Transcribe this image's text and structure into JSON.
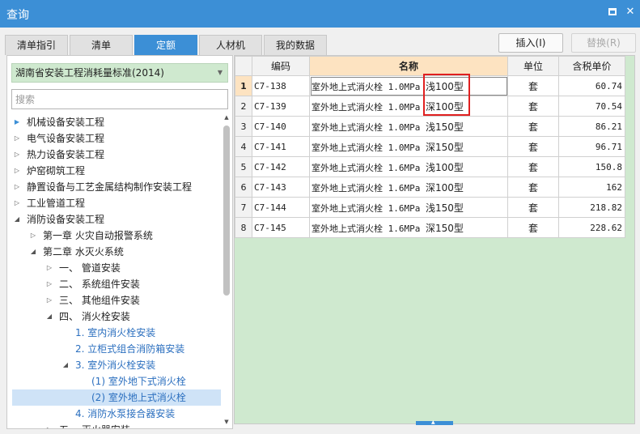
{
  "window": {
    "title": "查询"
  },
  "tabs": [
    {
      "label": "清单指引",
      "active": false
    },
    {
      "label": "清单",
      "active": false
    },
    {
      "label": "定额",
      "active": true
    },
    {
      "label": "人材机",
      "active": false
    },
    {
      "label": "我的数据",
      "active": false
    }
  ],
  "toolbar": {
    "insert_label": "插入(I)",
    "replace_label": "替换(R)"
  },
  "left": {
    "dropdown_value": "湖南省安装工程消耗量标准(2014)",
    "search_placeholder": "搜索",
    "tree": [
      {
        "label": "机械设备安装工程",
        "state": "collapsed",
        "selected_parent": true
      },
      {
        "label": "电气设备安装工程",
        "state": "collapsed"
      },
      {
        "label": "热力设备安装工程",
        "state": "collapsed"
      },
      {
        "label": "炉窑砌筑工程",
        "state": "collapsed"
      },
      {
        "label": "静置设备与工艺金属结构制作安装工程",
        "state": "collapsed"
      },
      {
        "label": "工业管道工程",
        "state": "collapsed"
      },
      {
        "label": "消防设备安装工程",
        "state": "expanded"
      },
      {
        "label": "第一章 火灾自动报警系统",
        "state": "collapsed"
      },
      {
        "label": "第二章 水灭火系统",
        "state": "expanded"
      },
      {
        "label": "一、 管道安装",
        "state": "collapsed"
      },
      {
        "label": "二、 系统组件安装",
        "state": "collapsed"
      },
      {
        "label": "三、 其他组件安装",
        "state": "collapsed"
      },
      {
        "label": "四、 消火栓安装",
        "state": "expanded"
      },
      {
        "label": "1. 室内消火栓安装",
        "state": "leaf"
      },
      {
        "label": "2. 立柜式组合消防箱安装",
        "state": "leaf"
      },
      {
        "label": "3. 室外消火栓安装",
        "state": "expanded"
      },
      {
        "label": "(1) 室外地下式消火栓",
        "state": "leaf"
      },
      {
        "label": "(2) 室外地上式消火栓",
        "state": "leaf",
        "selected": true
      },
      {
        "label": "4. 消防水泵接合器安装",
        "state": "leaf"
      },
      {
        "label": "五、 灭火器安装",
        "state": "collapsed"
      }
    ]
  },
  "grid": {
    "headers": {
      "code": "编码",
      "name": "名称",
      "unit": "单位",
      "price": "含税单价"
    },
    "rows": [
      {
        "no": "1",
        "code": "C7-138",
        "name_main": "室外地上式消火栓 1.0MPa ",
        "name_tail": "浅100型",
        "unit": "套",
        "price": "60.74"
      },
      {
        "no": "2",
        "code": "C7-139",
        "name_main": "室外地上式消火栓 1.0MPa ",
        "name_tail": "深100型",
        "unit": "套",
        "price": "70.54"
      },
      {
        "no": "3",
        "code": "C7-140",
        "name_main": "室外地上式消火栓 1.0MPa ",
        "name_tail": "浅150型",
        "unit": "套",
        "price": "86.21"
      },
      {
        "no": "4",
        "code": "C7-141",
        "name_main": "室外地上式消火栓 1.0MPa ",
        "name_tail": "深150型",
        "unit": "套",
        "price": "96.71"
      },
      {
        "no": "5",
        "code": "C7-142",
        "name_main": "室外地上式消火栓 1.6MPa ",
        "name_tail": "浅100型",
        "unit": "套",
        "price": "150.8"
      },
      {
        "no": "6",
        "code": "C7-143",
        "name_main": "室外地上式消火栓 1.6MPa ",
        "name_tail": "深100型",
        "unit": "套",
        "price": "162"
      },
      {
        "no": "7",
        "code": "C7-144",
        "name_main": "室外地上式消火栓 1.6MPa ",
        "name_tail": "浅150型",
        "unit": "套",
        "price": "218.82"
      },
      {
        "no": "8",
        "code": "C7-145",
        "name_main": "室外地上式消火栓 1.6MPa ",
        "name_tail": "深150型",
        "unit": "套",
        "price": "228.62"
      }
    ]
  },
  "colors": {
    "accent": "#3c8fd6",
    "highlight_box": "#e02020",
    "panel_green": "#cfe9cf"
  }
}
